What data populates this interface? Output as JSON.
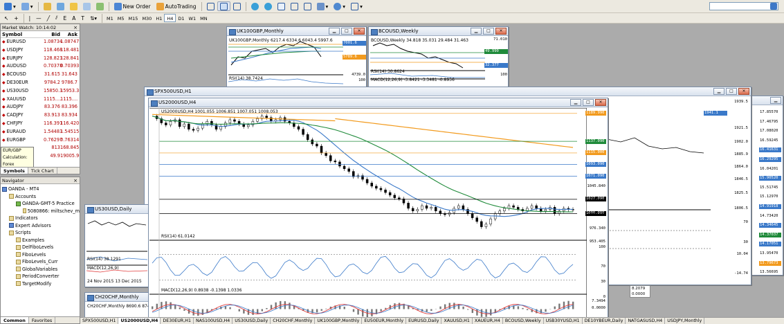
{
  "toolbar1": {
    "new_order": "New Order",
    "autotrading": "AutoTrading"
  },
  "toolbar2": {
    "timeframes": [
      "M1",
      "M5",
      "M15",
      "M30",
      "H1",
      "H4",
      "D1",
      "W1",
      "MN"
    ],
    "active": "H4"
  },
  "market_watch": {
    "title": "Market Watch: 10:14:02",
    "headers": {
      "symbol": "Symbol",
      "bid": "Bid",
      "ask": "Ask"
    },
    "rows": [
      {
        "symbol": "EURUSD",
        "bid": "1.08734",
        "ask": "1.08747"
      },
      {
        "symbol": "USDJPY",
        "bid": "118.468",
        "ask": "118.481"
      },
      {
        "symbol": "EURJPY",
        "bid": "128.823",
        "ask": "128.841"
      },
      {
        "symbol": "AUDUSD",
        "bid": "0.70378",
        "ask": "0.70393"
      },
      {
        "symbol": "BCOUSD",
        "bid": "31.615",
        "ask": "31.643"
      },
      {
        "symbol": "DE30EUR",
        "bid": "9784.2",
        "ask": "9786.7"
      },
      {
        "symbol": "US30USD",
        "bid": "15850.3",
        "ask": "15953.3"
      },
      {
        "symbol": "XAUUSD",
        "bid": "1115....",
        "ask": "1115...."
      },
      {
        "symbol": "AUDJPY",
        "bid": "83.376",
        "ask": "83.396"
      },
      {
        "symbol": "CADJPY",
        "bid": "83.913",
        "ask": "83.934"
      },
      {
        "symbol": "CHFJPY",
        "bid": "116.391",
        "ask": "116.420"
      },
      {
        "symbol": "EURAUD",
        "bid": "1.54483",
        "ask": "1.54515"
      },
      {
        "symbol": "EURGBP",
        "bid": "0.76297",
        "ask": "0.76314"
      },
      {
        "symbol": "",
        "bid": "813",
        "ask": "168.845"
      },
      {
        "symbol": "",
        "bid": "49.9",
        "ask": "19005.9"
      }
    ],
    "tooltip": [
      "EUR/GBP",
      "Calculation: Forex",
      "Trade: Full"
    ],
    "tabs": [
      "Symbols",
      "Tick Chart"
    ]
  },
  "navigator": {
    "title": "Navigator",
    "items": [
      {
        "label": "OANDA - MT4",
        "depth": 0
      },
      {
        "label": "Accounts",
        "depth": 1
      },
      {
        "label": "OANDA-GMT-5 Practice",
        "depth": 2
      },
      {
        "label": "5080866: miltschev_m",
        "depth": 3
      },
      {
        "label": "Indicators",
        "depth": 1
      },
      {
        "label": "Expert Advisors",
        "depth": 1
      },
      {
        "label": "Scripts",
        "depth": 1
      },
      {
        "label": "Examples",
        "depth": 2
      },
      {
        "label": "DelFiboLevels",
        "depth": 2
      },
      {
        "label": "FiboLevels",
        "depth": 2
      },
      {
        "label": "FiboLevels_Curr",
        "depth": 2
      },
      {
        "label": "GlobalVariables",
        "depth": 2
      },
      {
        "label": "PeriodConverter",
        "depth": 2
      },
      {
        "label": "TargetModify",
        "depth": 2
      }
    ],
    "tabs": [
      "Common",
      "Favorites"
    ]
  },
  "windows": {
    "uk100": {
      "title": "UK100GBP,Monthly",
      "info": "UK100GBP,Monthly 6217.4 6334.6 6043.4 5997.6",
      "rsi": "RSI(14) 38.7424",
      "prices": [
        "7001.6",
        "5789.6",
        "4739.0",
        "100"
      ]
    },
    "bco": {
      "title": "BCOUSD,Weekly",
      "info": "BCOUSD,Weekly 34.818 35.031 29.484 31.463",
      "rsi": "RSI(14) 30.8624",
      "macd": "MACD(12,26,9) -3.8421 -3.3481 -0.8936",
      "prices": [
        "71.010",
        "49.990",
        "32.377",
        "100"
      ]
    },
    "spx": {
      "title": "SPX500USD,H1",
      "prices": [
        "1939.5",
        "1921.5",
        "1902.0",
        "1885.9",
        "1864.0",
        "1846.5",
        "1825.5",
        "1806.5",
        "70",
        "30",
        "10.04",
        "-14.74"
      ],
      "lab_price": "1941.1"
    },
    "us30": {
      "title": "US30USD,Daily",
      "rsi": "RSI(14) 38.1291",
      "macd": "MACD(12,26,9)",
      "dates": "24 Nov 2015   13 Dec 2015"
    },
    "chf": {
      "title": "CH20CHF,Monthly",
      "info": "CH20CHF,Monthly 8690.6 8746.1"
    },
    "far": {
      "prices": [
        "17.85570",
        "17.46795",
        "17.08020",
        "16.59245",
        "16.41631",
        "16.29295",
        "16.04201",
        "15.90520",
        "15.51745",
        "15.12970",
        "14.91918",
        "14.73420",
        "14.34645",
        "14.37037",
        "14.17051",
        "13.95470",
        "13.79673",
        "13.56695"
      ]
    },
    "us2000": {
      "title": "US2000USD,H4",
      "info": "US2000USD,H4  1001.055 1006.851 1007.051 1008.053",
      "rsi": "RSI(14) 61.0142",
      "macd": "MACD(12,26,9) 0.8938 -0.1398 1.0336",
      "prices": [
        "1045.840",
        "1010.590",
        "999.275",
        "976.340",
        "953.405",
        "100",
        "70",
        "30",
        "0",
        "7.3494",
        "0.0000",
        "-6.4"
      ],
      "levels": [
        "1189.990",
        "1137.090",
        "1115.000",
        "1093.090",
        "1071.090",
        "1027.090",
        "1000.090"
      ]
    },
    "bottom_values": [
      "8.2079",
      "0.0000"
    ]
  },
  "bottom_tabs": [
    "SPX500USD,H1",
    "US2000USD,H4",
    "DE30EUR,H1",
    "NAS100USD,H4",
    "US30USD,Daily",
    "CH20CHF,Monthly",
    "UK100GBP,Monthly",
    "EU50EUR,Monthly",
    "EURUSD,Daily",
    "XAUUSD,H1",
    "XAUEUR,H4",
    "BCOUSD,Weekly",
    "USB30YUSD,H1",
    "DE10YBEUR,Daily",
    "NATGASUSD,H4",
    "USDJPY,Monthly"
  ],
  "active_tab": "US2000USD,H4",
  "colors": {
    "ma_blue": "#3a79c9",
    "ma_green": "#1f8a3a",
    "ma_orange": "#f29a1d",
    "macd_red": "#e03c3c"
  }
}
